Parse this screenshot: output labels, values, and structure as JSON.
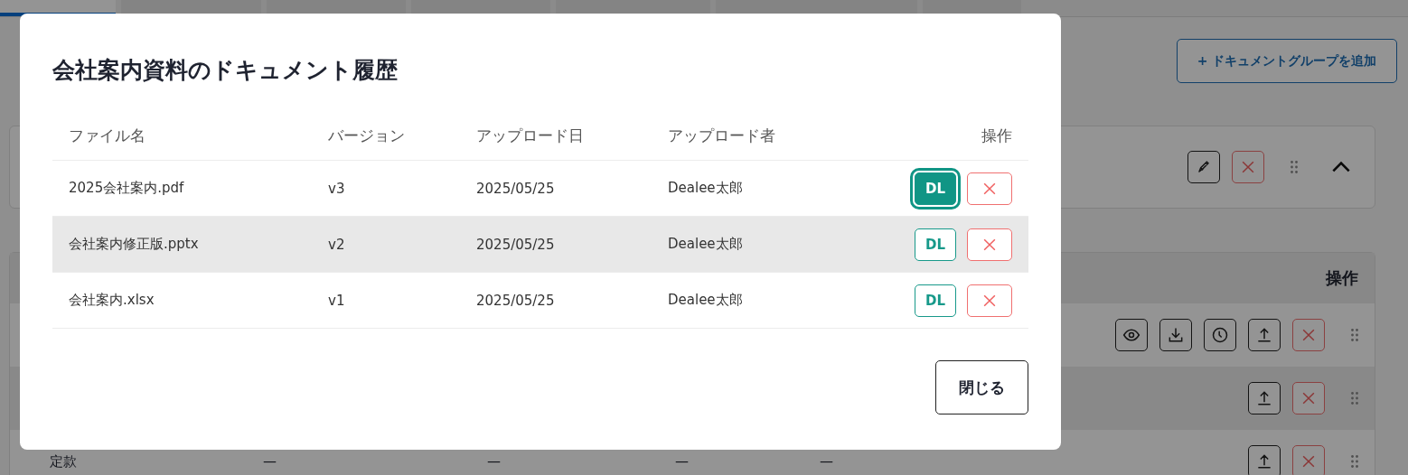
{
  "background": {
    "tabs": [
      {
        "selected": true
      },
      {
        "selected": false
      },
      {
        "selected": false
      },
      {
        "selected": false
      },
      {
        "selected": false
      },
      {
        "selected": false
      },
      {
        "selected": false
      }
    ],
    "add_group_button": "+ ドキュメントグループを追加",
    "group_card": {
      "expanded": true,
      "actions": [
        {
          "kind": "edit"
        },
        {
          "kind": "delete"
        }
      ]
    },
    "documents_table": {
      "columns": [
        "操作"
      ],
      "rows": [
        {
          "cells": [],
          "actions": [
            {
              "kind": "view"
            },
            {
              "kind": "download"
            },
            {
              "kind": "history"
            },
            {
              "kind": "upload"
            },
            {
              "kind": "delete"
            }
          ]
        },
        {
          "cells": [],
          "actions": [
            {
              "kind": "upload"
            },
            {
              "kind": "delete"
            }
          ]
        },
        {
          "cells": [
            "定款",
            "—",
            "—",
            "—",
            "—"
          ],
          "actions": [
            {
              "kind": "upload"
            },
            {
              "kind": "delete"
            }
          ]
        }
      ]
    }
  },
  "dialog": {
    "title": "会社案内資料のドキュメント履歴",
    "columns": [
      "ファイル名",
      "バージョン",
      "アップロード日",
      "アップロード者",
      "操作"
    ],
    "rows": [
      {
        "file": "2025会社案内.pdf",
        "version": "v3",
        "date": "2025/05/25",
        "uploader": "Dealee太郎",
        "download": "DL",
        "focused": true,
        "hovered": false
      },
      {
        "file": "会社案内修正版.pptx",
        "version": "v2",
        "date": "2025/05/25",
        "uploader": "Dealee太郎",
        "download": "DL",
        "focused": false,
        "hovered": true
      },
      {
        "file": "会社案内.xlsx",
        "version": "v1",
        "date": "2025/05/25",
        "uploader": "Dealee太郎",
        "download": "DL",
        "focused": false,
        "hovered": false
      }
    ],
    "close_button": "閉じる"
  }
}
